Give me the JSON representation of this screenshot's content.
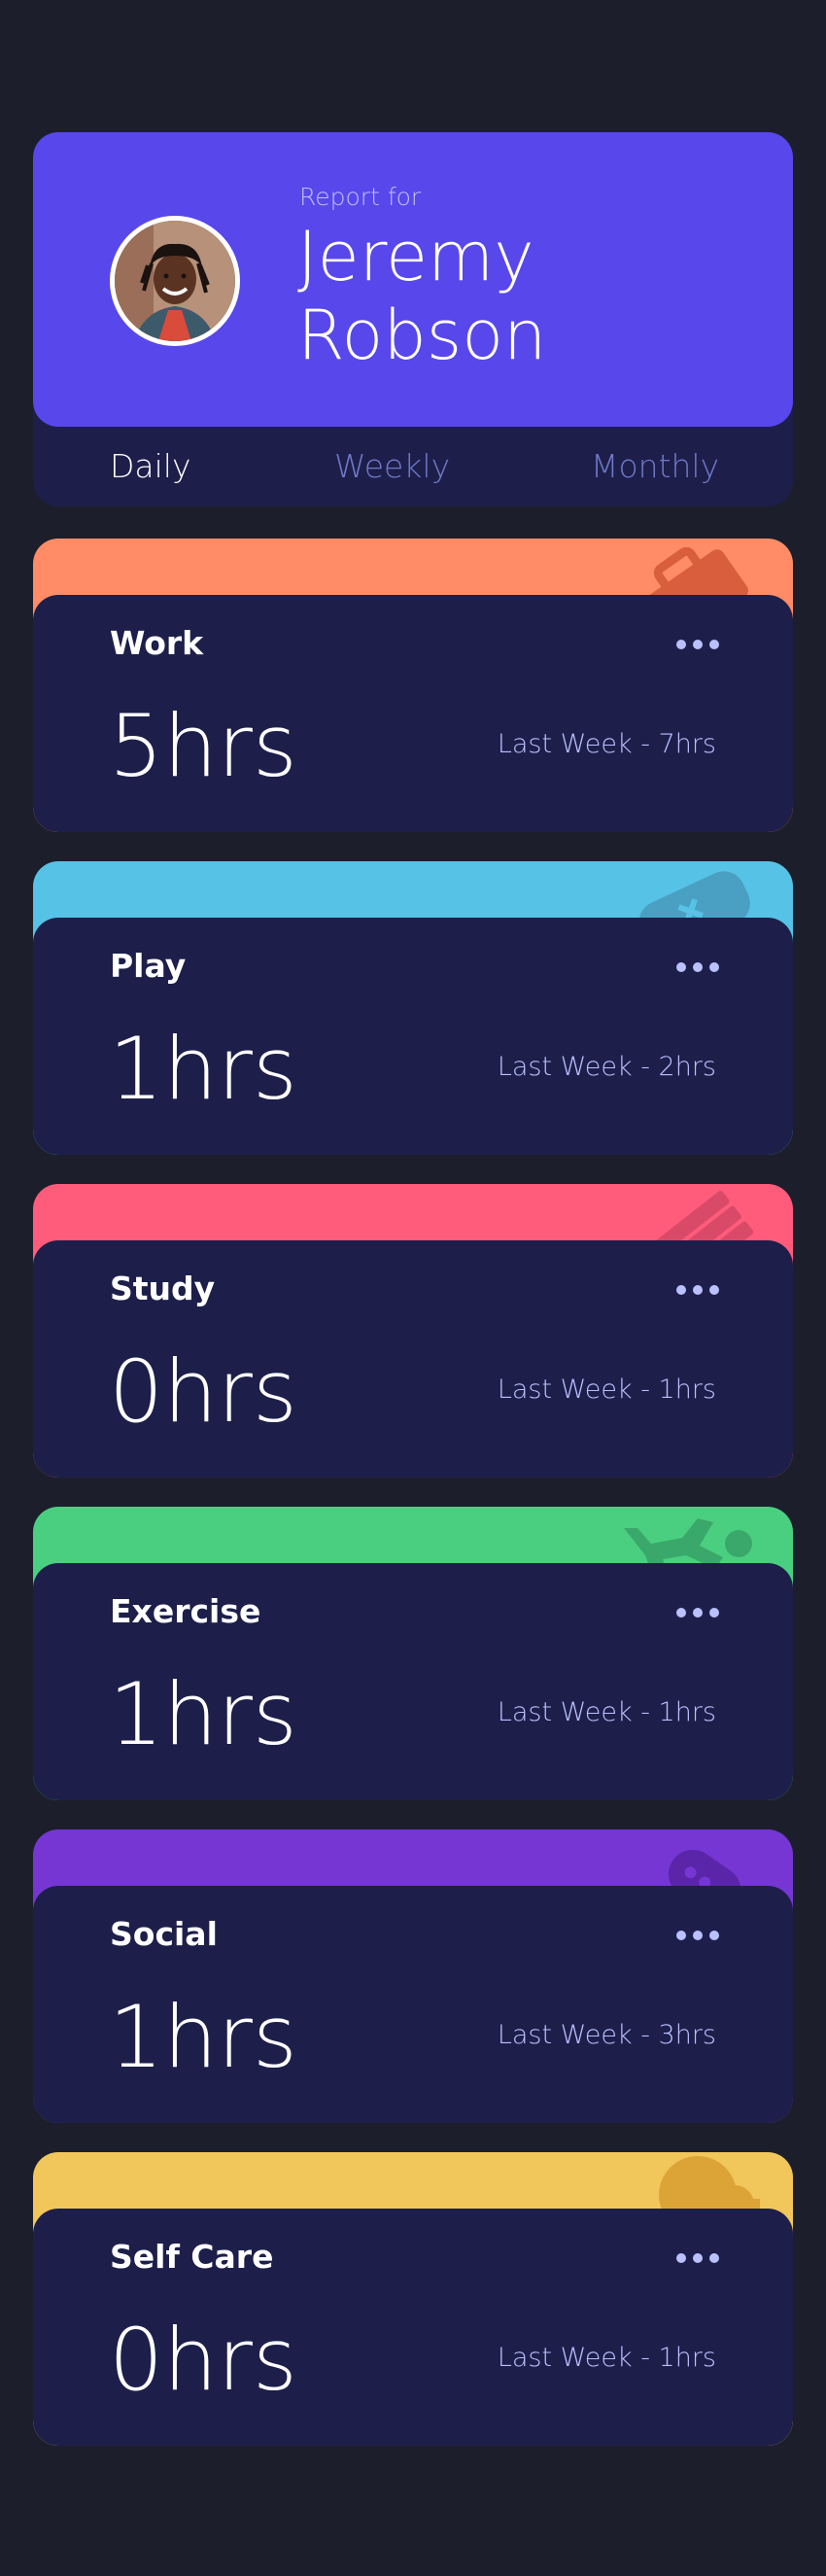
{
  "profile": {
    "report_label": "Report for",
    "name": "Jeremy Robson",
    "avatar_icon": "user-avatar"
  },
  "tabs": [
    {
      "label": "Daily",
      "active": true
    },
    {
      "label": "Weekly",
      "active": false
    },
    {
      "label": "Monthly",
      "active": false
    }
  ],
  "cards": [
    {
      "title": "Work",
      "hours": "5hrs",
      "last_week": "Last Week - 7hrs",
      "color": "#ff8c66",
      "icon": "briefcase-icon"
    },
    {
      "title": "Play",
      "hours": "1hrs",
      "last_week": "Last Week - 2hrs",
      "color": "#56c2e6",
      "icon": "gamepad-icon"
    },
    {
      "title": "Study",
      "hours": "0hrs",
      "last_week": "Last Week - 1hrs",
      "color": "#ff5c7c",
      "icon": "book-icon"
    },
    {
      "title": "Exercise",
      "hours": "1hrs",
      "last_week": "Last Week - 1hrs",
      "color": "#4acf81",
      "icon": "runner-icon"
    },
    {
      "title": "Social",
      "hours": "1hrs",
      "last_week": "Last Week - 3hrs",
      "color": "#7536d3",
      "icon": "speech-bubble-icon"
    },
    {
      "title": "Self Care",
      "hours": "0hrs",
      "last_week": "Last Week - 1hrs",
      "color": "#f1c65b",
      "icon": "heart-icon"
    }
  ]
}
